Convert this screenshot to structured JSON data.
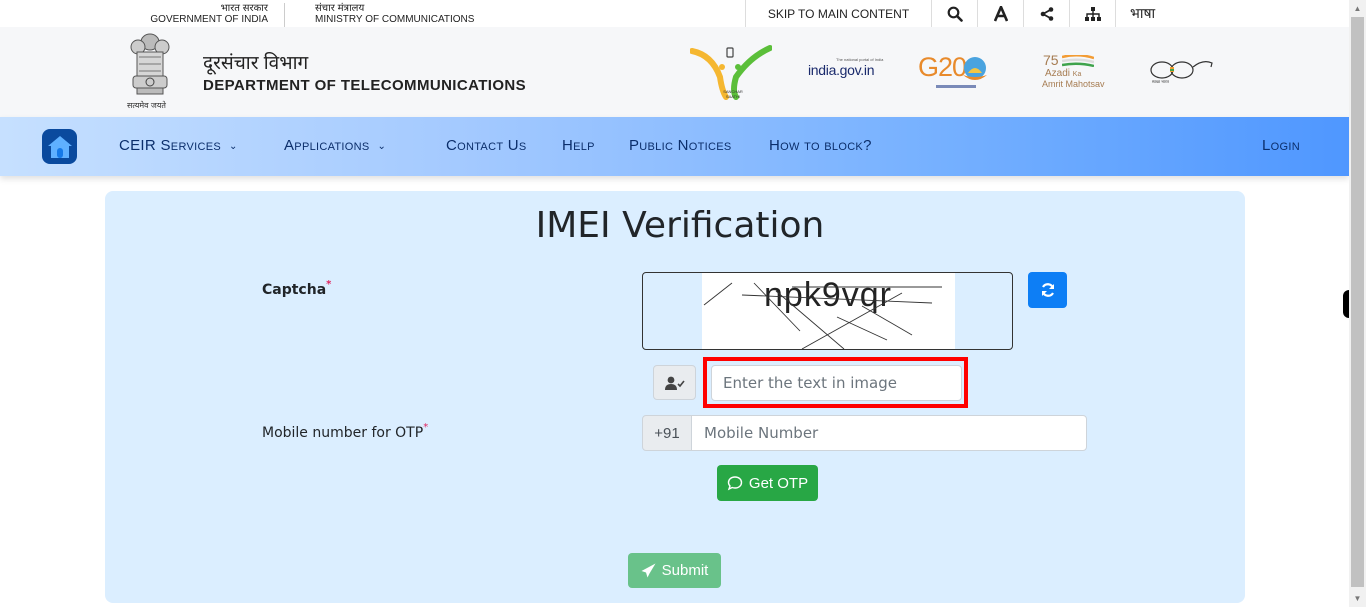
{
  "topbar": {
    "gov_hindi": "भारत सरकार",
    "gov_english": "GOVERNMENT OF INDIA",
    "ministry_hindi": "संचार मंत्रालय",
    "ministry_english": "MINISTRY OF COMMUNICATIONS",
    "skip_link": "SKIP TO MAIN CONTENT",
    "icons": [
      "search-icon",
      "font-size-icon",
      "share-icon",
      "sitemap-icon"
    ],
    "language_label": "भाषा"
  },
  "header": {
    "emblem_caption": "सत्यमेव जयते",
    "dept_hindi": "दूरसंचार विभाग",
    "dept_english": "DEPARTMENT OF TELECOMMUNICATIONS",
    "logos": {
      "sanchar_saathi": "SANCHAR SAATHI",
      "india_gov": "india.gov.in",
      "india_gov_tagline": "The national portal of India",
      "g20": "G20",
      "azadi_line1": "Azadi",
      "azadi_ka": "Ka",
      "azadi_line2": "Amrit Mahotsav",
      "swachh": "स्वच्छ भारत"
    }
  },
  "nav": {
    "items": [
      {
        "label": "CEIR Services",
        "dropdown": true
      },
      {
        "label": "Applications",
        "dropdown": true
      },
      {
        "label": "Contact Us",
        "dropdown": false
      },
      {
        "label": "Help",
        "dropdown": false
      },
      {
        "label": "Public Notices",
        "dropdown": false
      },
      {
        "label": "How to block?",
        "dropdown": false
      }
    ],
    "chevron": "⌄",
    "login": "Login"
  },
  "form": {
    "title": "IMEI Verification",
    "captcha_label": "Captcha",
    "required_mark": "*",
    "captcha_text": "npk9vqr",
    "captcha_placeholder": "Enter the text in image",
    "mobile_label": "Mobile number for OTP",
    "country_code": "+91",
    "mobile_placeholder": "Mobile Number",
    "get_otp": "Get OTP",
    "submit": "Submit"
  },
  "colors": {
    "nav_text": "#0b2e6b",
    "card_bg": "#dbeeff",
    "primary": "#0d7ef5",
    "success": "#28a745",
    "highlight": "#ff0000"
  }
}
